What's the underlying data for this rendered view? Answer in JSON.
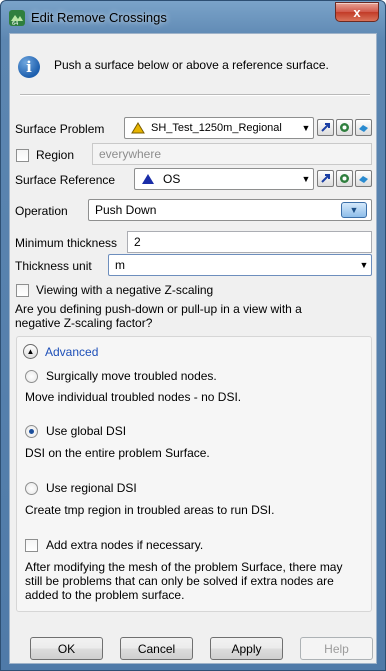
{
  "window": {
    "title": "Edit Remove Crossings",
    "close_glyph": "x"
  },
  "info": {
    "message": "Push a surface below or above a reference surface."
  },
  "surface_problem": {
    "label": "Surface Problem",
    "value": "SH_Test_1250m_Regional",
    "icon": "surface-triangle-icon",
    "icon_color": "#e7b400"
  },
  "region": {
    "label": "Region",
    "checked": false,
    "placeholder": "everywhere"
  },
  "surface_reference": {
    "label": "Surface Reference",
    "value": "OS",
    "icon": "surface-triangle-icon",
    "icon_color": "#1a2da8"
  },
  "operation": {
    "label": "Operation",
    "value": "Push Down"
  },
  "min_thickness": {
    "label": "Minimum thickness",
    "value": "2"
  },
  "thickness_unit": {
    "label": "Thickness unit",
    "value": "m"
  },
  "negative_z": {
    "checkbox_label": "Viewing with a negative Z-scaling",
    "question": "Are you defining push-down or pull-up in a view with a negative Z-scaling factor?"
  },
  "advanced": {
    "label": "Advanced",
    "options": [
      {
        "label": "Surgically move troubled nodes.",
        "description": "Move individual troubled nodes - no DSI.",
        "checked": false
      },
      {
        "label": "Use global DSI",
        "description": "DSI on the entire problem Surface.",
        "checked": true
      },
      {
        "label": "Use regional DSI",
        "description": "Create tmp region in troubled areas to run DSI.",
        "checked": false
      }
    ],
    "extra_nodes": {
      "label": "Add extra nodes if necessary.",
      "description": "After modifying the mesh of the problem Surface, there may still be problems that can only be solved if extra nodes are added to the problem surface."
    }
  },
  "buttons": {
    "ok": "OK",
    "cancel": "Cancel",
    "apply": "Apply",
    "help": "Help"
  },
  "colors": {
    "accent": "#1d4fb8",
    "titlebar": "#5c86b1"
  }
}
